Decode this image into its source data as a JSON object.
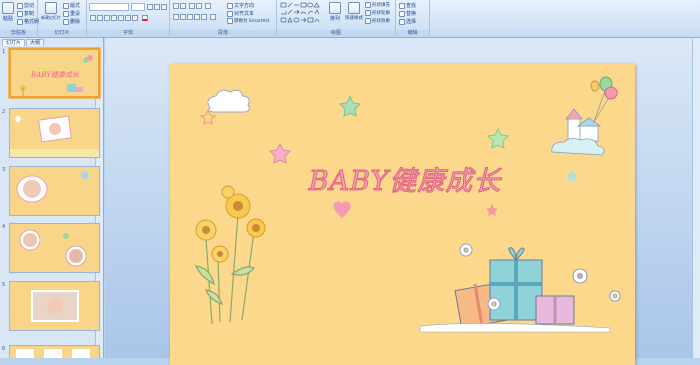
{
  "ribbon": {
    "clipboard": {
      "group_label": "剪贴板",
      "paste_label": "粘贴",
      "cut_label": "剪切",
      "copy_label": "复制",
      "format_painter_label": "格式刷"
    },
    "slides": {
      "group_label": "幻灯片",
      "new_slide_label": "新建幻灯片",
      "layout_label": "版式",
      "reset_label": "重设",
      "delete_label": "删除"
    },
    "font": {
      "group_label": "字体"
    },
    "paragraph": {
      "group_label": "段落",
      "text_direction_label": "文字方向",
      "align_text_label": "对齐文本",
      "smartart_label": "转换为 SmartArt"
    },
    "drawing": {
      "group_label": "绘图",
      "arrange_label": "排列",
      "quick_styles_label": "快速样式",
      "shape_fill_label": "形状填充",
      "shape_outline_label": "形状轮廓",
      "shape_effects_label": "形状效果"
    },
    "editing": {
      "group_label": "编辑",
      "find_label": "查找",
      "replace_label": "替换",
      "select_label": "选择"
    }
  },
  "panel": {
    "tabs": [
      {
        "label": "幻灯片"
      },
      {
        "label": "大纲"
      }
    ],
    "slide_numbers": [
      "1",
      "2",
      "3",
      "4",
      "5",
      "6"
    ],
    "thumb1_title": "BABY健康成长"
  },
  "slide": {
    "title": "BABY健康成长",
    "background_color": "#fbd88b",
    "title_color": "#f7a2b4"
  },
  "colors": {
    "ribbon": "#d5e5f7",
    "workspace": "#a9c5e9",
    "selection": "#f0a030"
  }
}
